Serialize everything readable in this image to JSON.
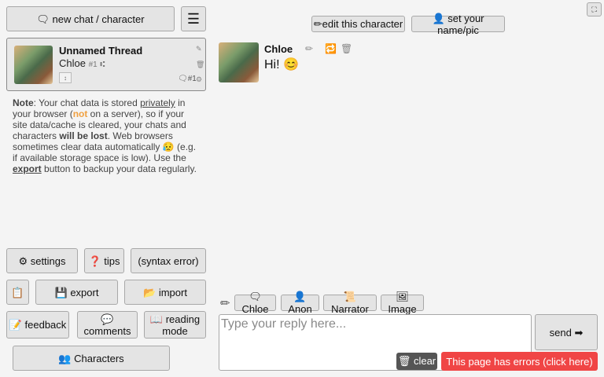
{
  "sidebar": {
    "new_chat_label": "🗨 new chat / character",
    "menu_label": "☰",
    "thread": {
      "title": "Unnamed Thread",
      "character": "Chloe",
      "id_tag": "#1",
      "branch_glyph": "⑆",
      "tag_glyph": "↕",
      "number": "🗨#1",
      "icons": [
        "✎",
        "🗑",
        "⚙"
      ]
    },
    "note": {
      "label_note": "Note",
      "t1": ": Your chat data is stored ",
      "privately": "privately",
      "t2": " in your browser (",
      "not": "not",
      "t3": " on a server), so if your site data/cache is cleared, your chats and characters ",
      "will_be_lost": "will be lost",
      "t4": ". Web browsers sometimes clear data automatically 😥 (e.g. if available storage space is low). Use the ",
      "export": "export",
      "t5": " button to backup your data regularly."
    },
    "buttons": {
      "settings": "⚙ settings",
      "tips": "❓ tips",
      "syntax": "(syntax error)",
      "square": "📋",
      "export": "💾 export",
      "import": "📂 import",
      "feedback": "📝 feedback",
      "comments": "💬 comments",
      "reading": "📖 reading mode",
      "characters": "👥 Characters"
    }
  },
  "header": {
    "edit_character": "✏edit this character",
    "set_name": "👤 set your name/pic",
    "corner": "⛶"
  },
  "message": {
    "name": "Chloe",
    "text": "Hi! 😊",
    "icons": [
      "✏",
      "🔁",
      "🗑"
    ]
  },
  "composer": {
    "pencil": "✏",
    "chips": [
      "🗨 Chloe",
      "👤 Anon",
      "📜 Narrator",
      "🖼 Image"
    ],
    "placeholder": "Type your reply here...",
    "send": "send ➡",
    "clear": "🗑 clear",
    "errors": "This page has errors (click here)"
  },
  "colors": {
    "background": "#f4f4f4",
    "button": "#e4e4e4",
    "error": "#f04545",
    "clear_button": "#555555",
    "note_highlight": "#f0a040"
  }
}
